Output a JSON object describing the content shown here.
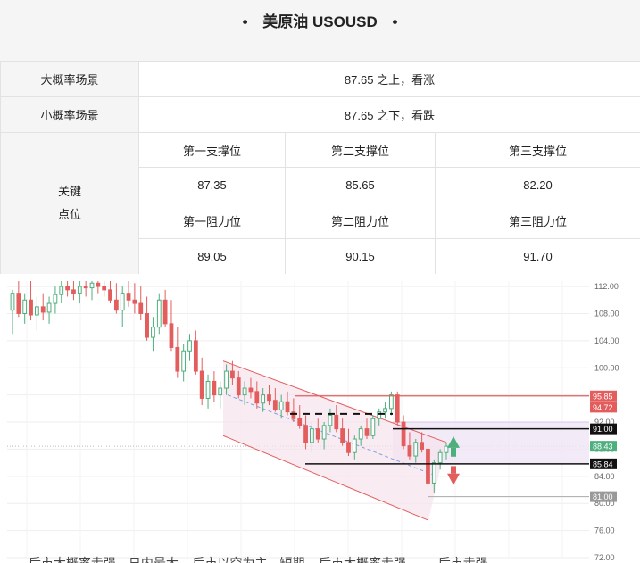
{
  "header": {
    "bullet_left": "•",
    "title": "美原油 USOUSD",
    "bullet_right": "•"
  },
  "scenarios": {
    "major_label": "大概率场景",
    "major_value": "87.65 之上，看涨",
    "minor_label": "小概率场景",
    "minor_value": "87.65 之下，看跌"
  },
  "key_points": {
    "label_line1": "关键",
    "label_line2": "点位",
    "support1_label": "第一支撑位",
    "support2_label": "第二支撑位",
    "support3_label": "第三支撑位",
    "support1": "87.35",
    "support2": "85.65",
    "support3": "82.20",
    "resistance1_label": "第一阻力位",
    "resistance2_label": "第二阻力位",
    "resistance3_label": "第三阻力位",
    "resistance1": "89.05",
    "resistance2": "90.15",
    "resistance3": "91.70"
  },
  "chart_data": {
    "type": "candlestick",
    "y_ticks": [
      112,
      108,
      104,
      100,
      96,
      92,
      88,
      84,
      80,
      76,
      72
    ],
    "y_tick_labels": [
      "112.00",
      "108.00",
      "104.00",
      "100.00",
      "96.00",
      "92.00",
      "88.00",
      "84.00",
      "80.00",
      "76.00",
      "72.00"
    ],
    "ylim": [
      72,
      112.8
    ],
    "price_tags": [
      {
        "value": 95.85,
        "label": "95.85",
        "color": "#e35d5d"
      },
      {
        "value": 94.72,
        "label": "94.72",
        "color": "#e35d5d"
      },
      {
        "value": 91.0,
        "label": "91.00",
        "color": "#111111"
      },
      {
        "value": 88.43,
        "label": "88.43",
        "color": "#4caf7d"
      },
      {
        "value": 85.84,
        "label": "85.84",
        "color": "#111111"
      },
      {
        "value": 81.0,
        "label": "81.00",
        "color": "#999999"
      }
    ],
    "candles": [
      [
        108.5,
        111.5,
        105.0,
        111.0
      ],
      [
        111.0,
        112.8,
        107.5,
        108.0
      ],
      [
        108.0,
        111.0,
        106.5,
        110.0
      ],
      [
        110.0,
        112.8,
        107.0,
        107.8
      ],
      [
        107.8,
        110.5,
        105.5,
        109.0
      ],
      [
        109.0,
        111.0,
        107.0,
        108.2
      ],
      [
        108.2,
        110.5,
        106.5,
        109.5
      ],
      [
        109.5,
        112.0,
        108.0,
        110.8
      ],
      [
        110.8,
        112.8,
        109.5,
        112.0
      ],
      [
        112.0,
        112.8,
        110.5,
        111.5
      ],
      [
        111.5,
        112.8,
        110.0,
        111.0
      ],
      [
        111.0,
        112.8,
        109.5,
        112.0
      ],
      [
        112.0,
        112.8,
        110.5,
        111.8
      ],
      [
        111.8,
        112.8,
        110.0,
        112.5
      ],
      [
        112.5,
        112.8,
        111.0,
        112.0
      ],
      [
        112.0,
        112.8,
        110.5,
        111.5
      ],
      [
        111.5,
        112.8,
        109.5,
        110.0
      ],
      [
        110.0,
        112.5,
        108.0,
        108.5
      ],
      [
        108.5,
        112.0,
        106.0,
        111.0
      ],
      [
        111.0,
        112.8,
        109.0,
        110.0
      ],
      [
        110.0,
        112.5,
        108.0,
        109.5
      ],
      [
        109.5,
        112.0,
        107.0,
        108.0
      ],
      [
        108.0,
        110.5,
        104.0,
        104.5
      ],
      [
        104.5,
        107.5,
        102.5,
        106.0
      ],
      [
        106.0,
        111.0,
        105.0,
        110.0
      ],
      [
        110.0,
        111.5,
        106.0,
        106.5
      ],
      [
        106.5,
        110.0,
        102.5,
        103.0
      ],
      [
        103.0,
        106.0,
        98.5,
        99.5
      ],
      [
        99.5,
        103.5,
        98.0,
        102.5
      ],
      [
        102.5,
        105.0,
        101.0,
        104.0
      ],
      [
        104.0,
        105.5,
        99.0,
        99.5
      ],
      [
        99.5,
        101.5,
        94.5,
        95.5
      ],
      [
        95.5,
        99.0,
        94.0,
        98.0
      ],
      [
        98.0,
        99.5,
        95.0,
        96.0
      ],
      [
        96.0,
        98.0,
        94.0,
        97.0
      ],
      [
        97.0,
        100.5,
        96.0,
        99.5
      ],
      [
        99.5,
        101.0,
        97.5,
        98.5
      ],
      [
        98.5,
        99.5,
        95.5,
        96.0
      ],
      [
        96.0,
        98.0,
        94.5,
        97.0
      ],
      [
        97.0,
        98.5,
        95.5,
        96.5
      ],
      [
        96.5,
        98.0,
        94.0,
        94.8
      ],
      [
        94.8,
        97.0,
        93.5,
        96.0
      ],
      [
        96.0,
        97.5,
        94.5,
        95.2
      ],
      [
        95.2,
        97.0,
        93.5,
        93.8
      ],
      [
        93.8,
        96.0,
        92.5,
        95.0
      ],
      [
        95.0,
        96.5,
        93.0,
        93.5
      ],
      [
        93.5,
        95.5,
        92.0,
        92.5
      ],
      [
        92.5,
        94.5,
        91.0,
        91.5
      ],
      [
        91.5,
        93.0,
        88.0,
        89.0
      ],
      [
        89.0,
        92.0,
        87.5,
        91.0
      ],
      [
        91.0,
        92.5,
        89.0,
        89.5
      ],
      [
        89.5,
        92.0,
        88.0,
        91.5
      ],
      [
        91.5,
        94.0,
        90.5,
        93.0
      ],
      [
        93.0,
        94.5,
        90.5,
        91.0
      ],
      [
        91.0,
        92.5,
        88.5,
        89.0
      ],
      [
        89.0,
        91.0,
        87.0,
        87.5
      ],
      [
        87.5,
        90.0,
        86.5,
        89.5
      ],
      [
        89.5,
        91.5,
        88.5,
        91.0
      ],
      [
        91.0,
        92.5,
        89.5,
        90.0
      ],
      [
        90.0,
        93.0,
        89.5,
        92.5
      ],
      [
        92.5,
        94.0,
        91.5,
        93.5
      ],
      [
        93.5,
        95.0,
        92.5,
        94.0
      ],
      [
        94.0,
        96.5,
        93.0,
        96.0
      ],
      [
        96.0,
        96.5,
        91.5,
        92.0
      ],
      [
        92.0,
        93.0,
        88.0,
        88.5
      ],
      [
        88.5,
        90.5,
        86.5,
        87.0
      ],
      [
        87.0,
        89.5,
        86.0,
        89.0
      ],
      [
        89.0,
        90.5,
        87.5,
        88.0
      ],
      [
        88.0,
        88.5,
        82.5,
        83.0
      ],
      [
        83.0,
        86.5,
        81.5,
        86.0
      ],
      [
        86.0,
        88.0,
        85.0,
        87.5
      ],
      [
        87.5,
        89.0,
        86.5,
        88.43
      ]
    ]
  },
  "footer": {
    "text": "—— 后市大概率走强，日内最大... 后市以空为主，短期... 后市大概率走强 —— 后市走强..."
  }
}
